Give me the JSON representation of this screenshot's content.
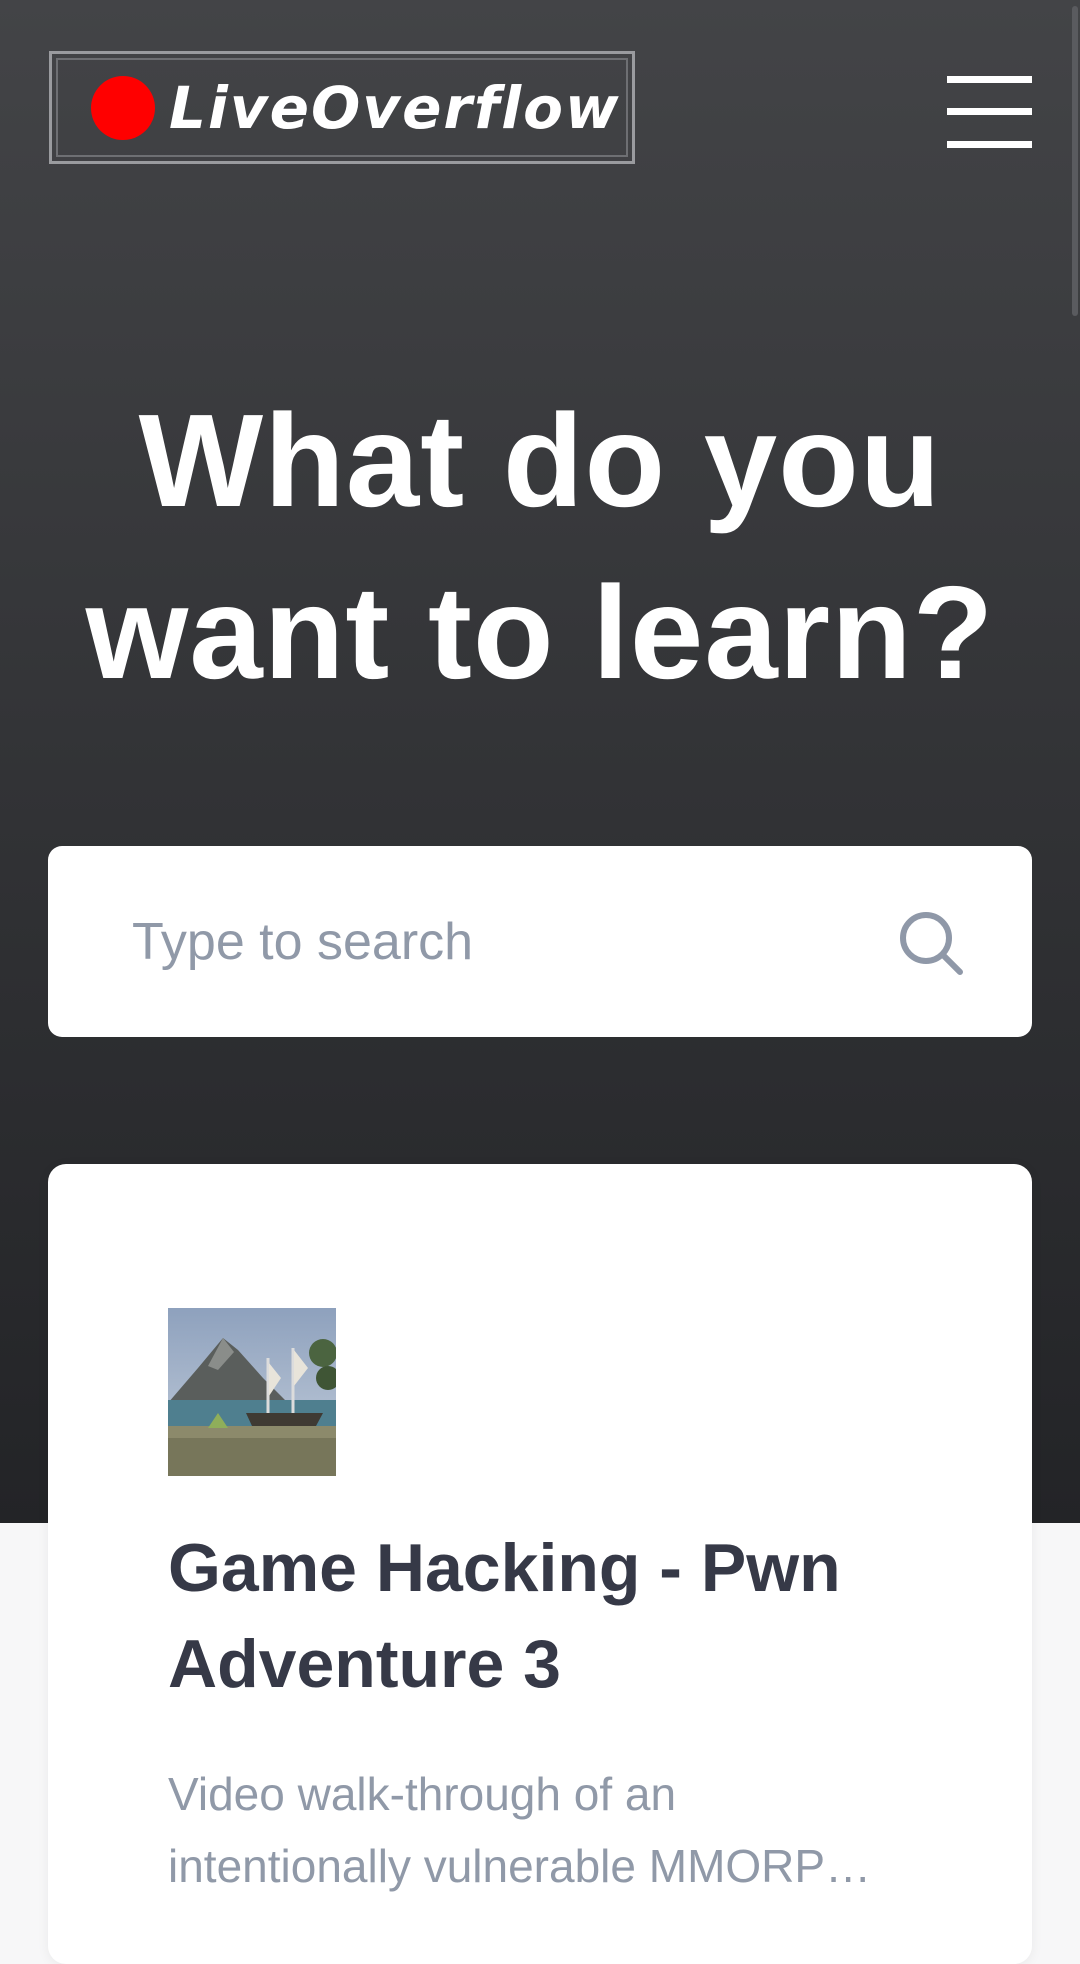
{
  "header": {
    "logo_text": "LiveOverflow",
    "logo_dot_color": "#ff0000",
    "menu_icon": "hamburger-menu-icon"
  },
  "hero": {
    "headline": "What do you want to learn?"
  },
  "search": {
    "placeholder": "Type to search",
    "value": "",
    "icon": "search-icon"
  },
  "course_card": {
    "thumbnail_alt": "Pwn Adventure 3 island scene",
    "title": "Game Hacking - Pwn Adventure 3",
    "description": "Video walk-through of an intentionally vulnerable MMORP…"
  }
}
